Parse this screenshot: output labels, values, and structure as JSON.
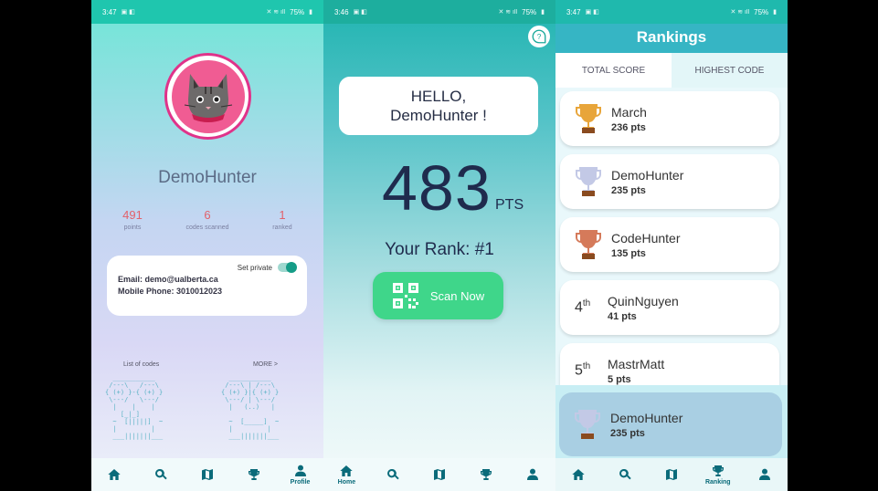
{
  "profile_screen": {
    "status": {
      "time": "3:47",
      "battery": "75%"
    },
    "username": "DemoHunter",
    "stats": [
      {
        "value": "491",
        "label": "points"
      },
      {
        "value": "6",
        "label": "codes scanned"
      },
      {
        "value": "1",
        "label": "ranked"
      }
    ],
    "set_private_label": "Set private",
    "set_private_on": true,
    "email_line": "Email: demo@ualberta.ca",
    "phone_line": "Mobile Phone: 3010012023",
    "list_of_codes_label": "List of codes",
    "more_label": "MORE >",
    "nav": [
      {
        "icon": "home-icon",
        "label": ""
      },
      {
        "icon": "search-icon",
        "label": ""
      },
      {
        "icon": "map-icon",
        "label": ""
      },
      {
        "icon": "trophy-icon",
        "label": ""
      },
      {
        "icon": "person-icon",
        "label": "Profile"
      }
    ]
  },
  "home_screen": {
    "status": {
      "time": "3:46",
      "battery": "75%"
    },
    "greeting_line1": "HELLO,",
    "greeting_line2": "DemoHunter !",
    "points": "483",
    "points_unit": "PTS",
    "rank_text": "Your Rank: #1",
    "scan_label": "Scan Now",
    "nav": [
      {
        "icon": "home-icon",
        "label": "Home"
      },
      {
        "icon": "search-icon",
        "label": ""
      },
      {
        "icon": "map-icon",
        "label": ""
      },
      {
        "icon": "trophy-icon",
        "label": ""
      },
      {
        "icon": "person-icon",
        "label": ""
      }
    ]
  },
  "rankings_screen": {
    "status": {
      "time": "3:47",
      "battery": "75%"
    },
    "title": "Rankings",
    "tabs": [
      "TOTAL SCORE",
      "HIGHEST CODE"
    ],
    "entries": [
      {
        "rank": "1",
        "name": "March",
        "score": "236 pts",
        "trophy": "gold"
      },
      {
        "rank": "2",
        "name": "DemoHunter",
        "score": "235 pts",
        "trophy": "silver"
      },
      {
        "rank": "3",
        "name": "CodeHunter",
        "score": "135 pts",
        "trophy": "bronze"
      },
      {
        "rank": "4",
        "suffix": "th",
        "name": "QuinNguyen",
        "score": "41 pts"
      },
      {
        "rank": "5",
        "suffix": "th",
        "name": "MastrMatt",
        "score": "5 pts"
      }
    ],
    "self_entry": {
      "name": "DemoHunter",
      "score": "235 pts"
    },
    "nav": [
      {
        "icon": "home-icon",
        "label": ""
      },
      {
        "icon": "search-icon",
        "label": ""
      },
      {
        "icon": "map-icon",
        "label": ""
      },
      {
        "icon": "trophy-icon",
        "label": "Ranking"
      },
      {
        "icon": "person-icon",
        "label": ""
      }
    ]
  },
  "colors": {
    "accent": "#1fb9ad",
    "scan_green": "#3fd68a",
    "points_red": "#e2616b",
    "avatar_pink": "#e0338a"
  }
}
